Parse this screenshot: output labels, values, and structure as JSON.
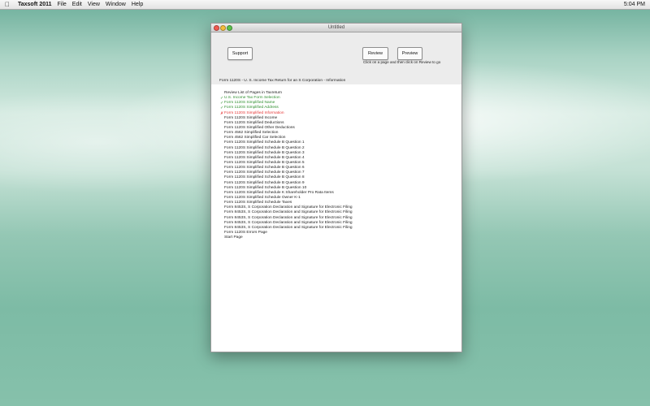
{
  "menubar": {
    "apple_icon": "apple-logo-icon",
    "app_name": "Taxsoft 2011",
    "menus": [
      "File",
      "Edit",
      "View",
      "Window",
      "Help"
    ],
    "clock": "5:04 PM"
  },
  "window": {
    "title": "Untitled",
    "buttons": {
      "support": "Support",
      "review": "Review",
      "preview": "Preview"
    },
    "hint": "Click on a page and then click on Review to go",
    "form_title": "Form 1120S - U. S. Income Tax Return for an S Corporation - Information",
    "list_heading": "Review List of Pages in Taxreturn",
    "pages": [
      {
        "label": "U.S. Income Tax Form Selection",
        "status": "done"
      },
      {
        "label": "Form 1120S Simplified Name",
        "status": "done"
      },
      {
        "label": "Form 1120S Simplified Address",
        "status": "done"
      },
      {
        "label": "Form 1120S Simplified Information",
        "status": "error"
      },
      {
        "label": "Form 1120S Simplified Income",
        "status": ""
      },
      {
        "label": "Form 1120S Simplified Deductions",
        "status": ""
      },
      {
        "label": "Form 1120S Simplified Other Deductions",
        "status": ""
      },
      {
        "label": "Form 4562 Simplified Selection",
        "status": ""
      },
      {
        "label": "Form 4562 Simplified Car Selection",
        "status": ""
      },
      {
        "label": "Form 1120S Simplified Schedule B Question 1",
        "status": ""
      },
      {
        "label": "Form 1120S Simplified Schedule B Question 2",
        "status": ""
      },
      {
        "label": "Form 1120S Simplified Schedule B Question 3",
        "status": ""
      },
      {
        "label": "Form 1120S Simplified Schedule B Question 4",
        "status": ""
      },
      {
        "label": "Form 1120S Simplified Schedule B Question 5",
        "status": ""
      },
      {
        "label": "Form 1120S Simplified Schedule B Question 6",
        "status": ""
      },
      {
        "label": "Form 1120S Simplified Schedule B Question 7",
        "status": ""
      },
      {
        "label": "Form 1120S Simplified Schedule B Question 8",
        "status": ""
      },
      {
        "label": "Form 1120S Simplified Schedule B Question 9",
        "status": ""
      },
      {
        "label": "Form 1120S Simplified Schedule B Question 10",
        "status": ""
      },
      {
        "label": "Form 1120S Simplified Schedule K Shareholder Pro Rata Items",
        "status": ""
      },
      {
        "label": "Form 1120S Simplified Schedule Owner K-1",
        "status": ""
      },
      {
        "label": "Form 1120S Simplified Schedule Taxes",
        "status": ""
      },
      {
        "label": "Form 8453S, S Corporation Declaration and Signature for Electronic Filing",
        "status": ""
      },
      {
        "label": "Form 8453S, S Corporation Declaration and Signature for Electronic Filing",
        "status": ""
      },
      {
        "label": "Form 8453S, S Corporation Declaration and Signature for Electronic Filing",
        "status": ""
      },
      {
        "label": "Form 8453S, S Corporation Declaration and Signature for Electronic Filing",
        "status": ""
      },
      {
        "label": "Form 8453S, S Corporation Declaration and Signature for Electronic Filing",
        "status": ""
      },
      {
        "label": "Form 1120S Errors Page",
        "status": ""
      },
      {
        "label": "Start Page",
        "status": ""
      }
    ]
  },
  "colors": {
    "done": "#2e8f2e",
    "error": "#e53535"
  }
}
